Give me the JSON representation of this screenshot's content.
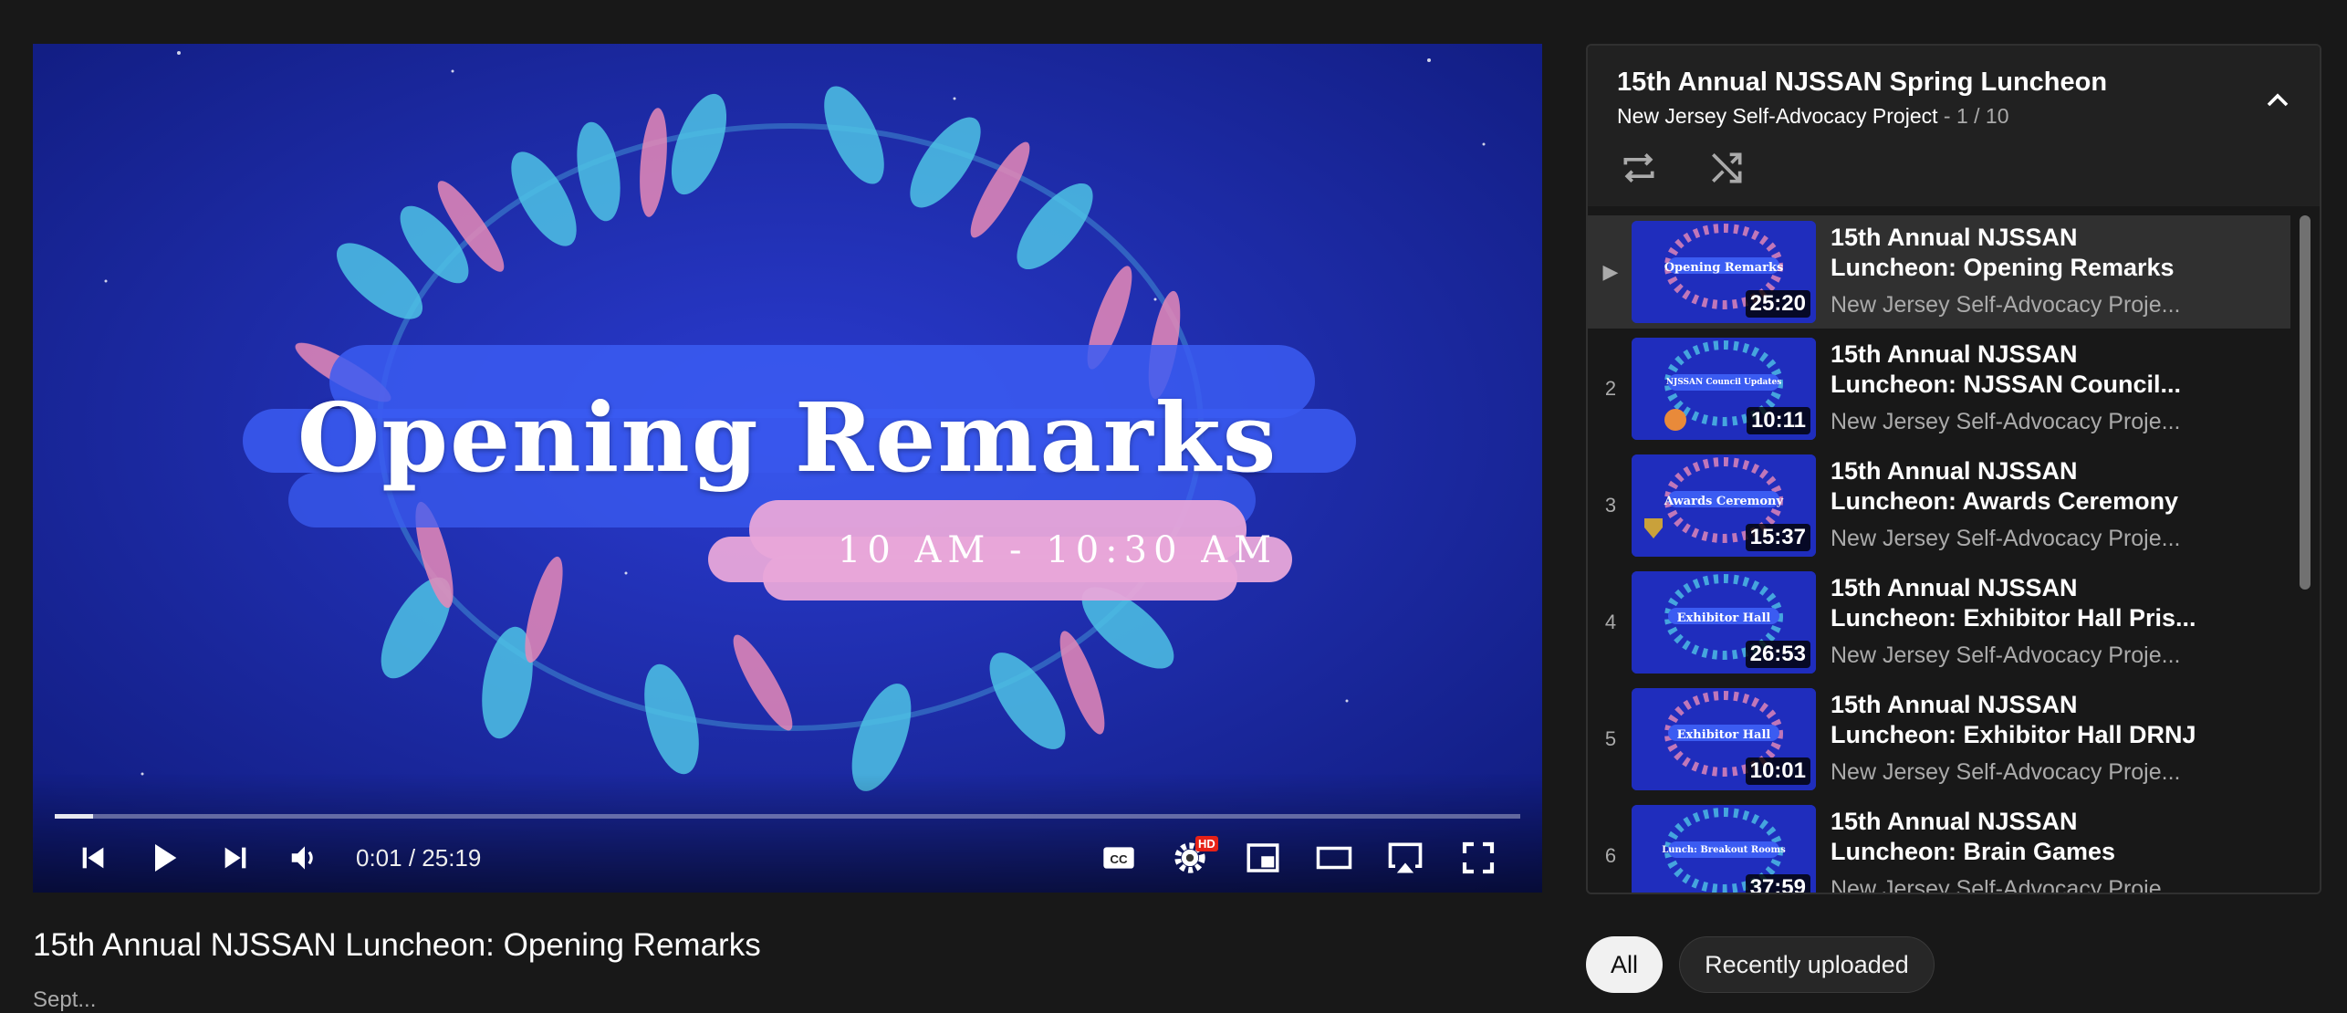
{
  "player": {
    "overlay_title": "Opening Remarks",
    "overlay_subtitle": "10 AM - 10:30 AM",
    "time_display": "0:01 / 25:19",
    "progress_fraction": 0.026,
    "hd_badge": "HD"
  },
  "playlist": {
    "title": "15th Annual NJSSAN Spring Luncheon",
    "channel": "New Jersey Self-Advocacy Project",
    "position": " - 1 / 10",
    "items": [
      {
        "index": "▶",
        "title_line1": "15th Annual NJSSAN",
        "title_line2": "Luncheon: Opening Remarks",
        "channel": "New Jersey Self-Advocacy Proje...",
        "duration": "25:20",
        "thumb_caption": "Opening Remarks"
      },
      {
        "index": "2",
        "title_line1": "15th Annual NJSSAN",
        "title_line2": "Luncheon: NJSSAN Council...",
        "channel": "New Jersey Self-Advocacy Proje...",
        "duration": "10:11",
        "thumb_caption": "NJSSAN Council Updates"
      },
      {
        "index": "3",
        "title_line1": "15th Annual NJSSAN",
        "title_line2": "Luncheon: Awards Ceremony",
        "channel": "New Jersey Self-Advocacy Proje...",
        "duration": "15:37",
        "thumb_caption": "Awards Ceremony"
      },
      {
        "index": "4",
        "title_line1": "15th Annual NJSSAN",
        "title_line2": "Luncheon: Exhibitor Hall Pris...",
        "channel": "New Jersey Self-Advocacy Proje...",
        "duration": "26:53",
        "thumb_caption": "Exhibitor Hall"
      },
      {
        "index": "5",
        "title_line1": "15th Annual NJSSAN",
        "title_line2": "Luncheon: Exhibitor Hall DRNJ",
        "channel": "New Jersey Self-Advocacy Proje...",
        "duration": "10:01",
        "thumb_caption": "Exhibitor Hall"
      },
      {
        "index": "6",
        "title_line1": "15th Annual NJSSAN",
        "title_line2": "Luncheon: Brain Games",
        "channel": "New Jersey Self-Advocacy Proje...",
        "duration": "37:59",
        "thumb_caption": "Lunch: Breakout Rooms"
      }
    ]
  },
  "video": {
    "title": "15th Annual NJSSAN Luncheon: Opening Remarks",
    "date": "Sept..."
  },
  "chips": {
    "all": "All",
    "recent": "Recently uploaded"
  },
  "colors": {
    "page_bg": "#181818",
    "panel_bg": "#212121",
    "video_blue": "#1a2aa8",
    "hd_red": "#e62117"
  }
}
